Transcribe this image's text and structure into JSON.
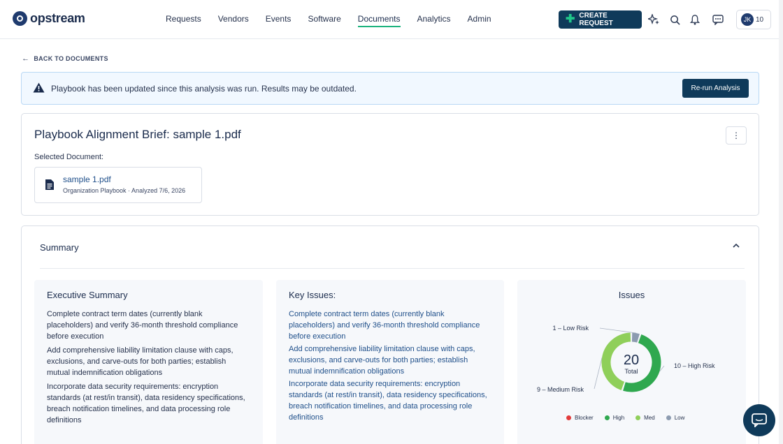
{
  "nav": {
    "logo": "opstream",
    "links": [
      "Requests",
      "Vendors",
      "Events",
      "Software",
      "Documents",
      "Analytics",
      "Admin"
    ],
    "active": "Documents",
    "create_label": "CREATE REQUEST",
    "avatar_initials": "JK",
    "avatar_count": "10"
  },
  "back_label": "BACK TO DOCUMENTS",
  "banner": {
    "text": "Playbook has been updated since this analysis was run. Results may be outdated.",
    "button": "Re-run Analysis"
  },
  "brief": {
    "title": "Playbook Alignment Brief: sample 1.pdf",
    "selected_label": "Selected Document:",
    "doc_name": "sample 1.pdf",
    "doc_meta": "Organization Playbook · Analyzed 7/6, 2026"
  },
  "summary": {
    "title": "Summary",
    "exec_title": "Executive Summary",
    "exec_p1": "Complete contract term dates (currently blank placeholders) and verify 36-month threshold compliance before execution",
    "exec_p2": "Add comprehensive liability limitation clause with caps, exclusions, and carve-outs for both parties; establish mutual indemnification obligations",
    "exec_p3": "Incorporate data security requirements: encryption standards (at rest/in transit), data residency specifications, breach notification timelines, and data processing role definitions",
    "key_title": "Key Issues:",
    "key_p1": "Complete contract term dates (currently blank placeholders) and verify 36-month threshold compliance before execution",
    "key_p2": "Add comprehensive liability limitation clause with caps, exclusions, and carve-outs for both parties; establish mutual indemnification obligations",
    "key_p3": "Incorporate data security requirements: encryption standards (at rest/in transit), data residency specifications, breach notification timelines, and data processing role definitions",
    "issues_title": "Issues"
  },
  "chart_data": {
    "type": "pie",
    "title": "Issues",
    "center_value": "20",
    "center_label": "Total",
    "slices": [
      {
        "label": "1 – Low Risk",
        "value": 1,
        "color": "#8c9bb0"
      },
      {
        "label": "10 – High Risk",
        "value": 10,
        "color": "#2fa84f"
      },
      {
        "label": "9 – Medium Risk",
        "value": 9,
        "color": "#8fcf5a"
      }
    ],
    "legend": [
      "Blocker",
      "High",
      "Med",
      "Low"
    ],
    "legend_colors": [
      "#e23b3b",
      "#2fa84f",
      "#8fcf5a",
      "#8c9bb0"
    ],
    "legend_position": "bottom"
  }
}
